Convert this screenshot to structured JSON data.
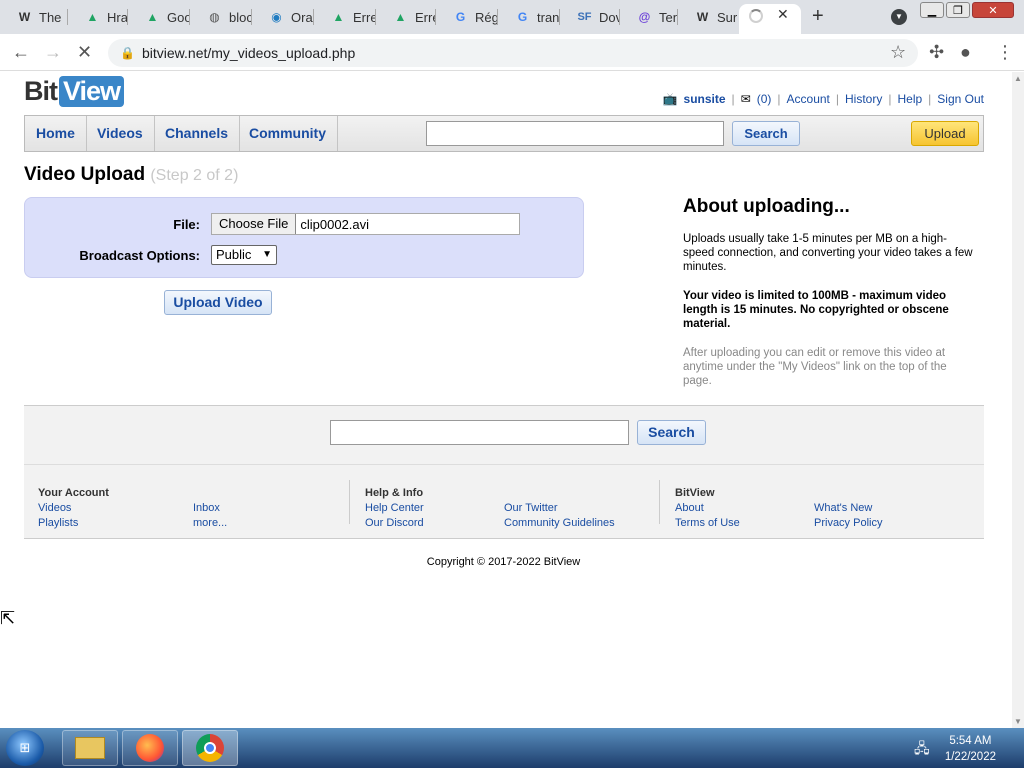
{
  "browser": {
    "tabs": [
      {
        "icon": "wikipedia-icon",
        "label": "The"
      },
      {
        "icon": "google-drive-icon",
        "label": "Hra"
      },
      {
        "icon": "google-drive-icon",
        "label": "Goo"
      },
      {
        "icon": "globe-icon",
        "label": "bloc"
      },
      {
        "icon": "oracle-icon",
        "label": "Ora"
      },
      {
        "icon": "google-drive-icon",
        "label": "Erre"
      },
      {
        "icon": "google-drive-icon",
        "label": "Erre"
      },
      {
        "icon": "google-icon",
        "label": "Rég"
      },
      {
        "icon": "google-icon",
        "label": "tran"
      },
      {
        "icon": "sourceforge-icon",
        "label": "Dov"
      },
      {
        "icon": "at-icon",
        "label": "Ten"
      },
      {
        "icon": "wikipedia-icon",
        "label": "Sur"
      }
    ],
    "url": "bitview.net/my_videos_upload.php"
  },
  "site": {
    "logo_bit": "Bit",
    "logo_view": "View",
    "user": {
      "username": "sunsite",
      "inbox_count": "(0)",
      "links": [
        "Account",
        "History",
        "Help",
        "Sign Out"
      ]
    },
    "nav": [
      "Home",
      "Videos",
      "Channels",
      "Community"
    ],
    "search_button": "Search",
    "upload_button": "Upload"
  },
  "main": {
    "title": "Video Upload",
    "step": "(Step 2 of 2)",
    "file_label": "File:",
    "choose_file": "Choose File",
    "file_name": "clip0002.avi",
    "broadcast_label": "Broadcast Options:",
    "broadcast_value": "Public",
    "upload_video_button": "Upload Video"
  },
  "about": {
    "title": "About uploading...",
    "p1": "Uploads usually take 1-5 minutes per MB on a high-speed connection, and converting your video takes a few minutes.",
    "p2": "Your video is limited to 100MB - maximum video length is 15 minutes. No copyrighted or obscene material.",
    "p3": "After uploading you can edit or remove this video at anytime under the \"My Videos\" link on the top of the page."
  },
  "footer": {
    "search_button": "Search",
    "your_account": {
      "heading": "Your Account",
      "links": [
        "Videos",
        "Playlists",
        "Inbox",
        "more..."
      ]
    },
    "help_info": {
      "heading": "Help & Info",
      "links": [
        "Help Center",
        "Our Discord",
        "Our Twitter",
        "Community Guidelines"
      ]
    },
    "bitview": {
      "heading": "BitView",
      "links": [
        "About",
        "Terms of Use",
        "What's New",
        "Privacy Policy"
      ]
    },
    "copyright": "Copyright © 2017-2022 BitView"
  },
  "taskbar": {
    "time": "5:54 AM",
    "date": "1/22/2022"
  }
}
